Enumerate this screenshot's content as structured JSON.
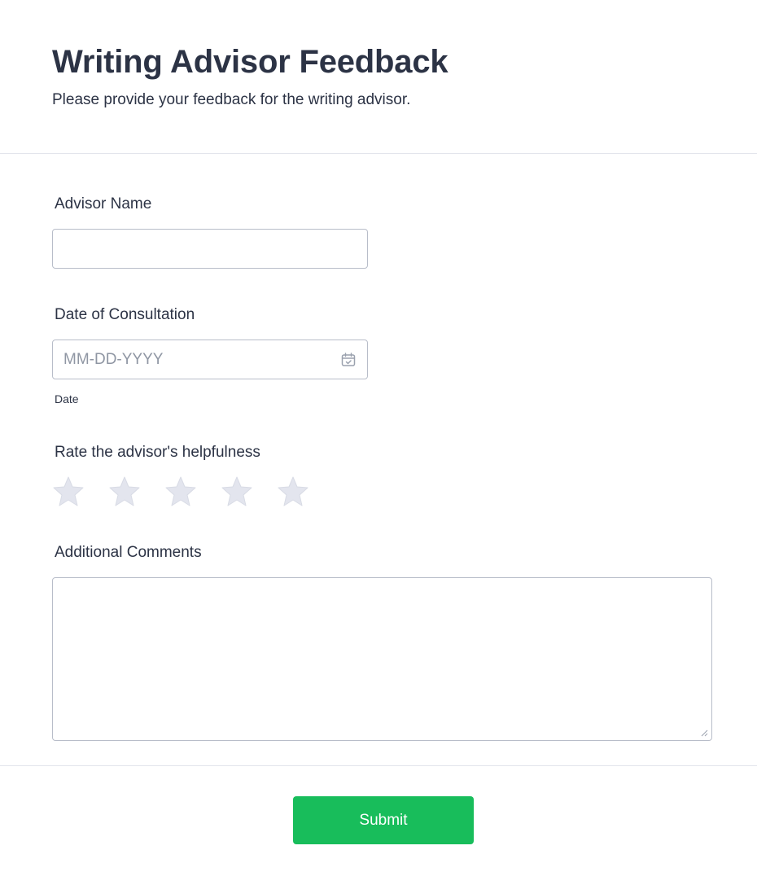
{
  "form": {
    "title": "Writing Advisor Feedback",
    "subtitle": "Please provide your feedback for the writing advisor."
  },
  "fields": {
    "advisor_name": {
      "label": "Advisor Name",
      "value": ""
    },
    "date": {
      "label": "Date of Consultation",
      "placeholder": "MM-DD-YYYY",
      "sublabel": "Date",
      "icon": "calendar-icon"
    },
    "rating": {
      "label": "Rate the advisor's helpfulness",
      "max": 5,
      "selected": 0,
      "icon": "star-icon"
    },
    "comments": {
      "label": "Additional Comments",
      "value": ""
    }
  },
  "submit": {
    "label": "Submit"
  },
  "colors": {
    "text": "#2c3345",
    "border": "#b8bdc9",
    "placeholder": "#8f96a3",
    "star_empty": "#e3e5ee",
    "submit_bg": "#18bd5b",
    "divider": "#e3e5ec"
  }
}
